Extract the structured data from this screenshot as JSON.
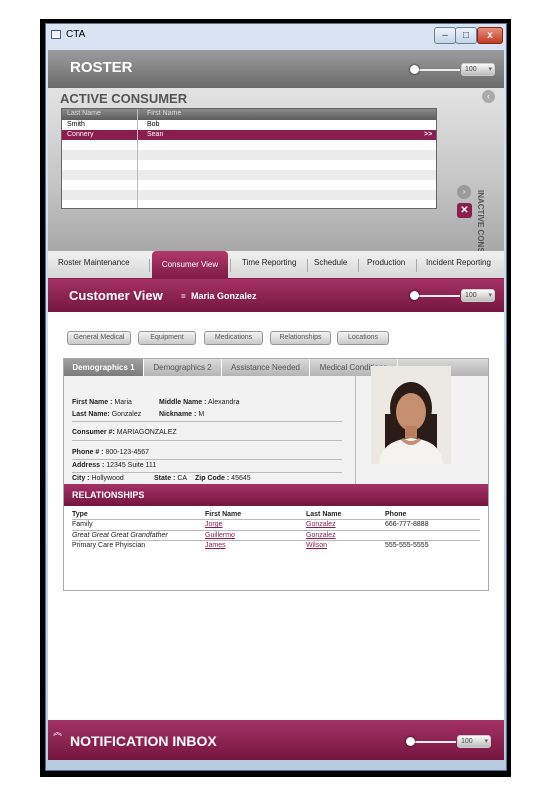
{
  "window": {
    "title": "CTA",
    "min_label": "–",
    "max_label": "□",
    "close_label": "x"
  },
  "roster": {
    "title": "ROSTER",
    "zoom": "100"
  },
  "active_consumer": {
    "title": "ACTIVE CONSUMER",
    "columns": [
      "Last Name",
      "First Name"
    ],
    "rows": [
      {
        "last": "Smith",
        "first": "Bob"
      },
      {
        "last": "Connery",
        "first": "Sean",
        "marker": ">>"
      }
    ],
    "inactive_label": "INACTIVE CONSUMER"
  },
  "tabs": [
    "Roster Maintenance",
    "Consumer View",
    "Time Reporting",
    "Schedule",
    "Production",
    "Incident Reporting"
  ],
  "customer_view": {
    "title": "Customer View",
    "sep": "=",
    "name": "Maria Gonzalez",
    "zoom": "100"
  },
  "sub_buttons": [
    "General Medical",
    "Equipment",
    "Medications",
    "Relationships",
    "Locations"
  ],
  "demo_tabs": [
    "Demographics 1",
    "Demographics 2",
    "Assistance Needed",
    "Medical Conditions"
  ],
  "fields": {
    "first_name_label": "First Name :",
    "first_name": "Maria",
    "middle_name_label": "Middle Name :",
    "middle_name": "Alexandra",
    "last_name_label": "Last Name:",
    "last_name": "Gonzalez",
    "nickname_label": "Nickname :",
    "nickname": "M",
    "consumer_label": "Consumer #:",
    "consumer": "MARIAGONZALEZ",
    "phone_label": "Phone # :",
    "phone": "800-123-4567",
    "address_label": "Address :",
    "address": "12345  Suite 111",
    "city_label": "City :",
    "city": "Hollywood",
    "state_label": "State :",
    "state": "CA",
    "zip_label": "Zip Code :",
    "zip": "45645"
  },
  "relationships": {
    "title": "RELATIONSHIPS",
    "headers": [
      "Type",
      "First Name",
      "Last Name",
      "Phone"
    ],
    "rows": [
      {
        "type": "Family",
        "first": "Jorge",
        "last": "Gonzalez",
        "phone": "666-777-8888"
      },
      {
        "type": "Great Great Great Grandfather",
        "first": "Guillermo",
        "last": "Gonzalez",
        "phone": ""
      },
      {
        "type": "Primary Care Phyiscian",
        "first": "James",
        "last": "Wilson",
        "phone": "555-555-5555"
      }
    ]
  },
  "notification": {
    "title": "NOTIFICATION INBOX",
    "chevron": "︽",
    "zoom": "100"
  },
  "colors": {
    "accent": "#8a1f4d",
    "accent_light": "#a43265",
    "gray_bar": "#7a7a7a"
  }
}
